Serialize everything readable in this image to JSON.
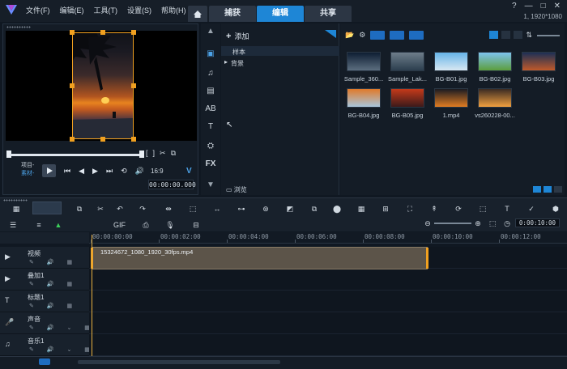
{
  "app": {
    "menu": [
      "文件(F)",
      "编辑(E)",
      "工具(T)",
      "设置(S)",
      "帮助(H)"
    ],
    "tabs": [
      {
        "label": "捕获",
        "active": false
      },
      {
        "label": "编辑",
        "active": true
      },
      {
        "label": "共享",
        "active": false
      }
    ],
    "window_controls": [
      "?",
      "—",
      "□",
      "✕"
    ],
    "project_resolution": "1, 1920*1080",
    "accent_color": "#1e86d6"
  },
  "player": {
    "mode_project": "项目-",
    "mode_clip": "素材-",
    "timecode": "00:00:00.000",
    "aspect_ratio": "16:9",
    "bracket_icons": [
      "[",
      "]"
    ]
  },
  "library": {
    "add_label": "添加",
    "tree": [
      {
        "label": "样本",
        "selected": true
      },
      {
        "label": "背景",
        "selected": false
      }
    ],
    "browse_label": "浏览",
    "side_tools": [
      "媒体",
      "音乐",
      "转场",
      "标题",
      "T",
      "图形",
      "FX"
    ],
    "thumbnails": [
      {
        "caption": "Sample_360...",
        "colors": [
          "#0e1e33",
          "#5c6e7f"
        ]
      },
      {
        "caption": "Sample_Lak...",
        "colors": [
          "#6e7d8a",
          "#2b3e4e"
        ]
      },
      {
        "caption": "BG-B01.jpg",
        "colors": [
          "#66b4e8",
          "#d8e8f2"
        ]
      },
      {
        "caption": "BG-B02.jpg",
        "colors": [
          "#7ec3ee",
          "#5c9e3c"
        ]
      },
      {
        "caption": "BG-B03.jpg",
        "colors": [
          "#1d2f55",
          "#c05a2a"
        ]
      },
      {
        "caption": "BG-B04.jpg",
        "colors": [
          "#e07a2a",
          "#a8c6dc"
        ]
      },
      {
        "caption": "BG-B05.jpg",
        "colors": [
          "#c43a1a",
          "#3c1a1a"
        ]
      },
      {
        "caption": "1.mp4",
        "colors": [
          "#1a1b22",
          "#e07c22"
        ]
      },
      {
        "caption": "vs260228-00...",
        "colors": [
          "#3a2a22",
          "#f0a040"
        ]
      }
    ]
  },
  "timeline": {
    "timecode": "0:00:10:00",
    "ruler": [
      "00:00:00:00",
      "00:00:02:00",
      "00:00:04:00",
      "00:00:06:00",
      "00:00:08:00",
      "00:00:10:00",
      "00:00:12:00"
    ],
    "tracks": [
      {
        "name": "视频",
        "icon": "video-track-icon"
      },
      {
        "name": "叠加1",
        "icon": "overlay-track-icon"
      },
      {
        "name": "标题1",
        "icon": "title-track-icon"
      },
      {
        "name": "声音",
        "icon": "voice-track-icon"
      },
      {
        "name": "音乐1",
        "icon": "music-track-icon"
      }
    ],
    "clip_name": "15324672_1080_1920_30fps.mp4"
  }
}
